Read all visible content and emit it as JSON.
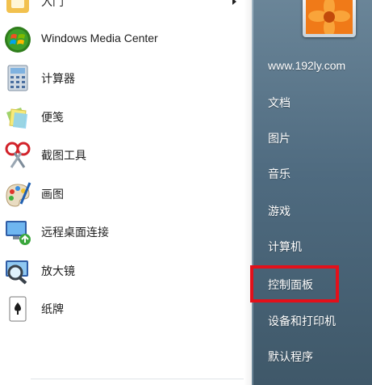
{
  "left_menu": {
    "items": [
      {
        "label": "入门",
        "icon": "getting-started-icon",
        "has_submenu": true
      },
      {
        "label": "Windows Media Center",
        "icon": "windows-media-center-icon"
      },
      {
        "label": "计算器",
        "icon": "calculator-icon"
      },
      {
        "label": "便笺",
        "icon": "sticky-notes-icon"
      },
      {
        "label": "截图工具",
        "icon": "snipping-tool-icon"
      },
      {
        "label": "画图",
        "icon": "paint-icon"
      },
      {
        "label": "远程桌面连接",
        "icon": "remote-desktop-icon"
      },
      {
        "label": "放大镜",
        "icon": "magnifier-icon"
      },
      {
        "label": "纸牌",
        "icon": "solitaire-icon"
      }
    ]
  },
  "right_menu": {
    "items": [
      {
        "label": "www.192ly.com"
      },
      {
        "label": "文档"
      },
      {
        "label": "图片"
      },
      {
        "label": "音乐"
      },
      {
        "label": "游戏"
      },
      {
        "label": "计算机"
      },
      {
        "label": "控制面板",
        "highlighted": true
      },
      {
        "label": "设备和打印机"
      },
      {
        "label": "默认程序"
      }
    ]
  },
  "colors": {
    "right_pane_top": "#6a8598",
    "right_pane_bottom": "#3f5869",
    "highlight_border": "#e3101a"
  },
  "user_picture": {
    "icon": "flower-user-picture"
  }
}
